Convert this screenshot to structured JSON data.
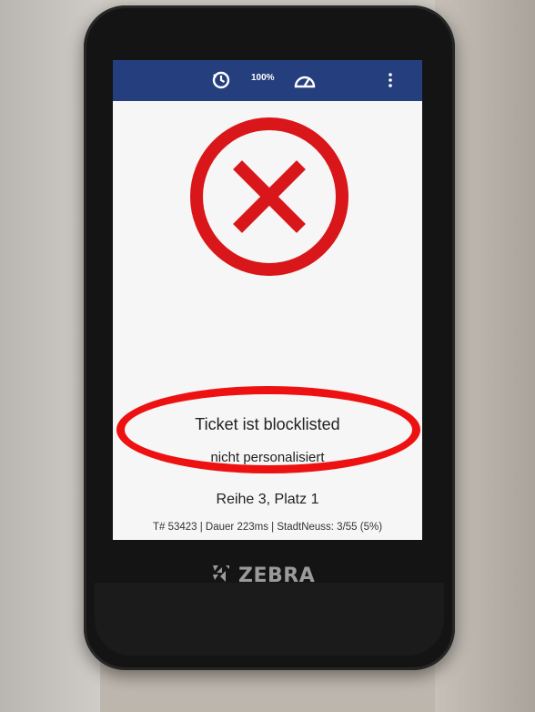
{
  "status_bar": {
    "history_icon": "history-clock-icon",
    "battery_text": "100%",
    "signal_icon": "speed-gauge-icon",
    "menu_icon": "overflow-menu-icon",
    "bg_color": "#253f7e"
  },
  "result": {
    "icon": "error-x-circle-icon",
    "color": "#d9161a",
    "message": "Ticket ist blocklisted",
    "detail": "nicht personalisiert",
    "seat": "Reihe 3, Platz 1"
  },
  "footer": {
    "info": "T# 53423 | Dauer 223ms | StadtNeuss: 3/55 (5%)"
  },
  "device": {
    "brand": "ZEBRA"
  }
}
